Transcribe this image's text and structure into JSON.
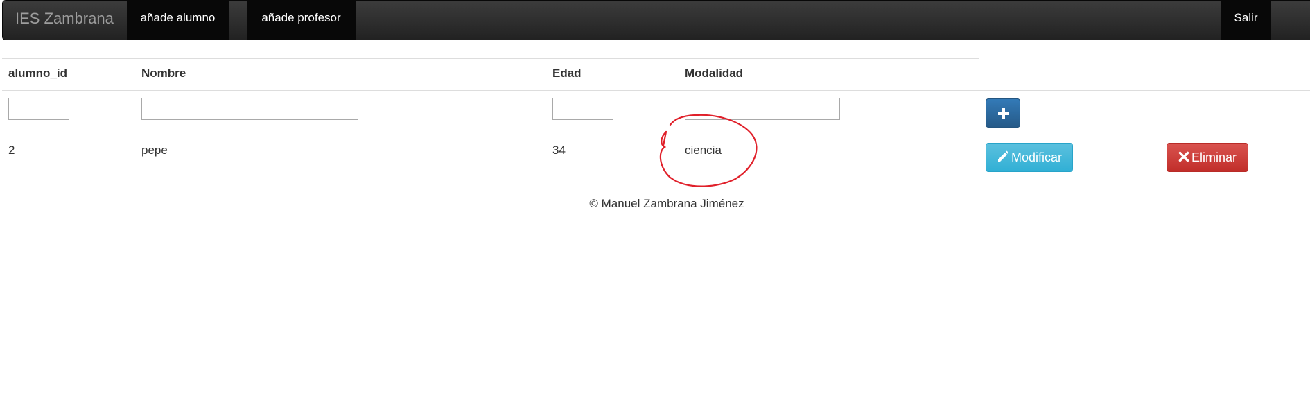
{
  "navbar": {
    "brand": "IES Zambrana",
    "items": [
      {
        "label": "añade alumno"
      },
      {
        "label": "añade profesor"
      }
    ],
    "logout_label": "Salir",
    "background": "#222222",
    "active_background": "#080808"
  },
  "table": {
    "columns": [
      "alumno_id",
      "Nombre",
      "Edad",
      "Modalidad"
    ],
    "new_row": {
      "alumno_id": "",
      "nombre": "",
      "edad": "",
      "modalidad": ""
    },
    "add_button_icon": "plus-icon",
    "rows": [
      {
        "alumno_id": "2",
        "nombre": "pepe",
        "edad": "34",
        "modalidad": "ciencia",
        "modify_label": "Modificar",
        "modify_icon": "pencil-icon",
        "delete_label": "Eliminar",
        "delete_icon": "close-icon"
      }
    ]
  },
  "footer": {
    "text": "© Manuel Zambrana Jiménez"
  },
  "colors": {
    "primary": "#337ab7",
    "info": "#5bc0de",
    "danger": "#d9534f",
    "annotation": "#e0202a"
  }
}
